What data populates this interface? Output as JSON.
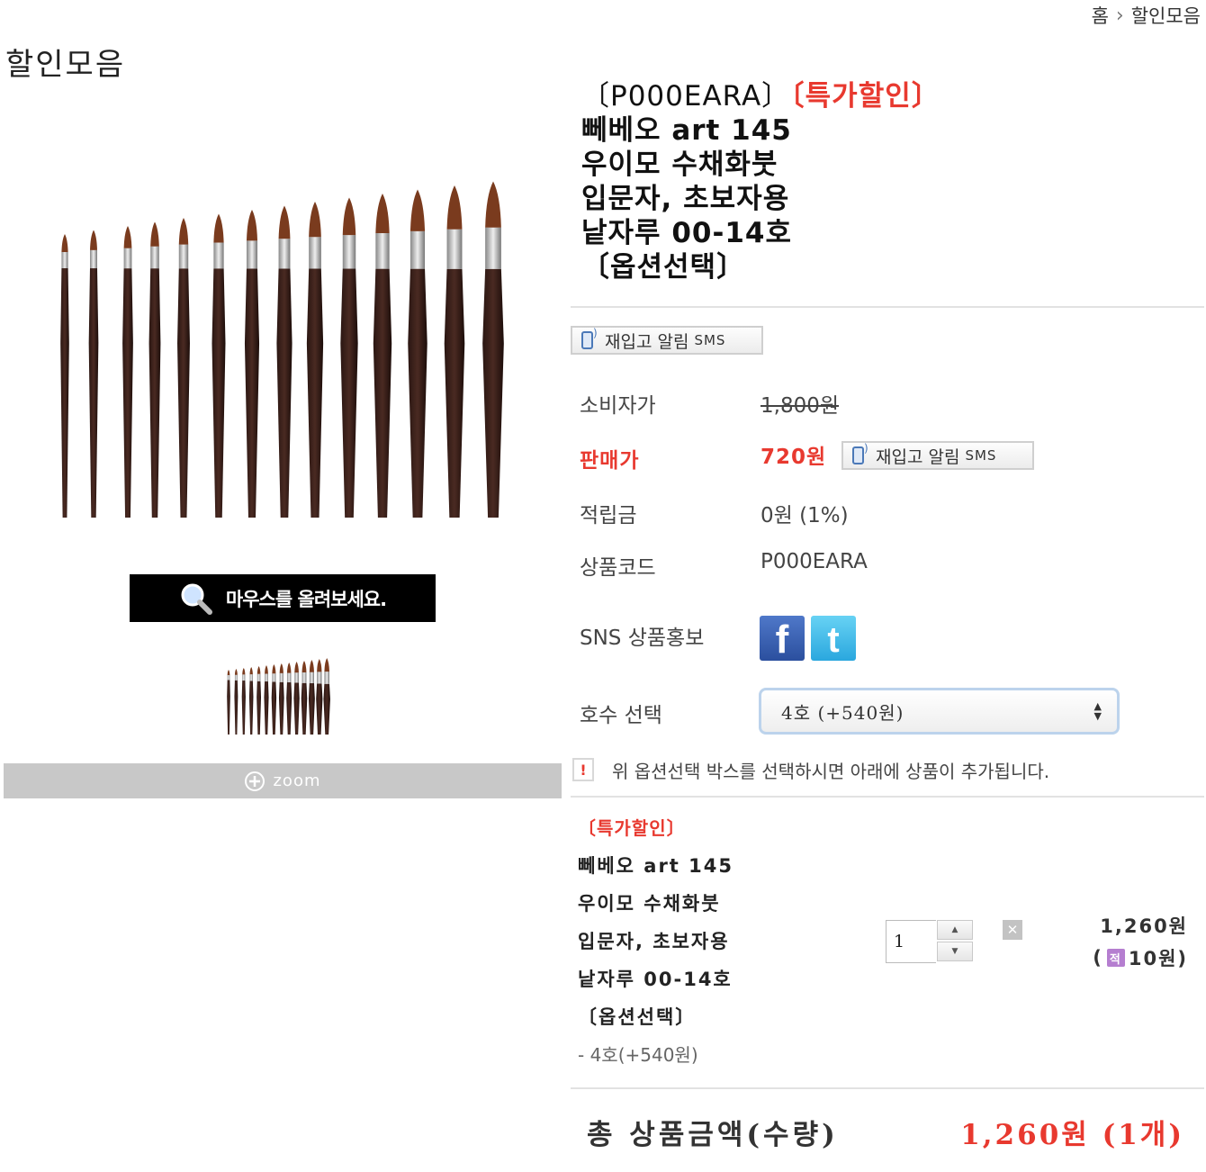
{
  "breadcrumb": {
    "home": "홈",
    "current": "할인모음"
  },
  "page_title": "할인모음",
  "left": {
    "zoom_hint": "마우스를 올려보세요.",
    "zoom_label": "zoom"
  },
  "product": {
    "code_bracket": "〔P000EARA〕",
    "tag": "〔특가할인〕",
    "name_lines": [
      "뻬베오 art 145",
      "우이모 수채화붓",
      "입문자, 초보자용",
      "낱자루 00-14호",
      "〔옵션선택〕"
    ]
  },
  "restock": {
    "label": "재입고 알림",
    "sms": "SMS"
  },
  "info": {
    "consumer_label": "소비자가",
    "consumer_value": "1,800원",
    "price_label": "판매가",
    "price_value": "720원",
    "points_label": "적립금",
    "points_value": "0원 (1%)",
    "code_label": "상품코드",
    "code_value": "P000EARA",
    "sns_label": "SNS 상품홍보",
    "option_label": "호수 선택",
    "option_value": "4호 (+540원)"
  },
  "sns_icons": {
    "facebook": "f",
    "twitter": "t"
  },
  "notice": {
    "icon": "!",
    "text": "위 옵션선택 박스를 선택하시면 아래에 상품이 추가됩니다."
  },
  "selected_item": {
    "tag": "〔특가할인〕",
    "lines": [
      "뻬베오 art 145",
      "우이모 수채화붓",
      "입문자, 초보자용",
      "낱자루 00-14호",
      "〔옵션선택〕"
    ],
    "option": "- 4호(+540원)",
    "quantity": "1",
    "price": "1,260원",
    "points_open": "(",
    "points_icon": "적",
    "points_value": "10원)"
  },
  "total": {
    "label": "총 상품금액(수량)",
    "value": "1,260원 (1개)"
  },
  "colors": {
    "accent_red": "#e8392f",
    "facebook": "#3b5998",
    "twitter": "#2aa7de"
  }
}
